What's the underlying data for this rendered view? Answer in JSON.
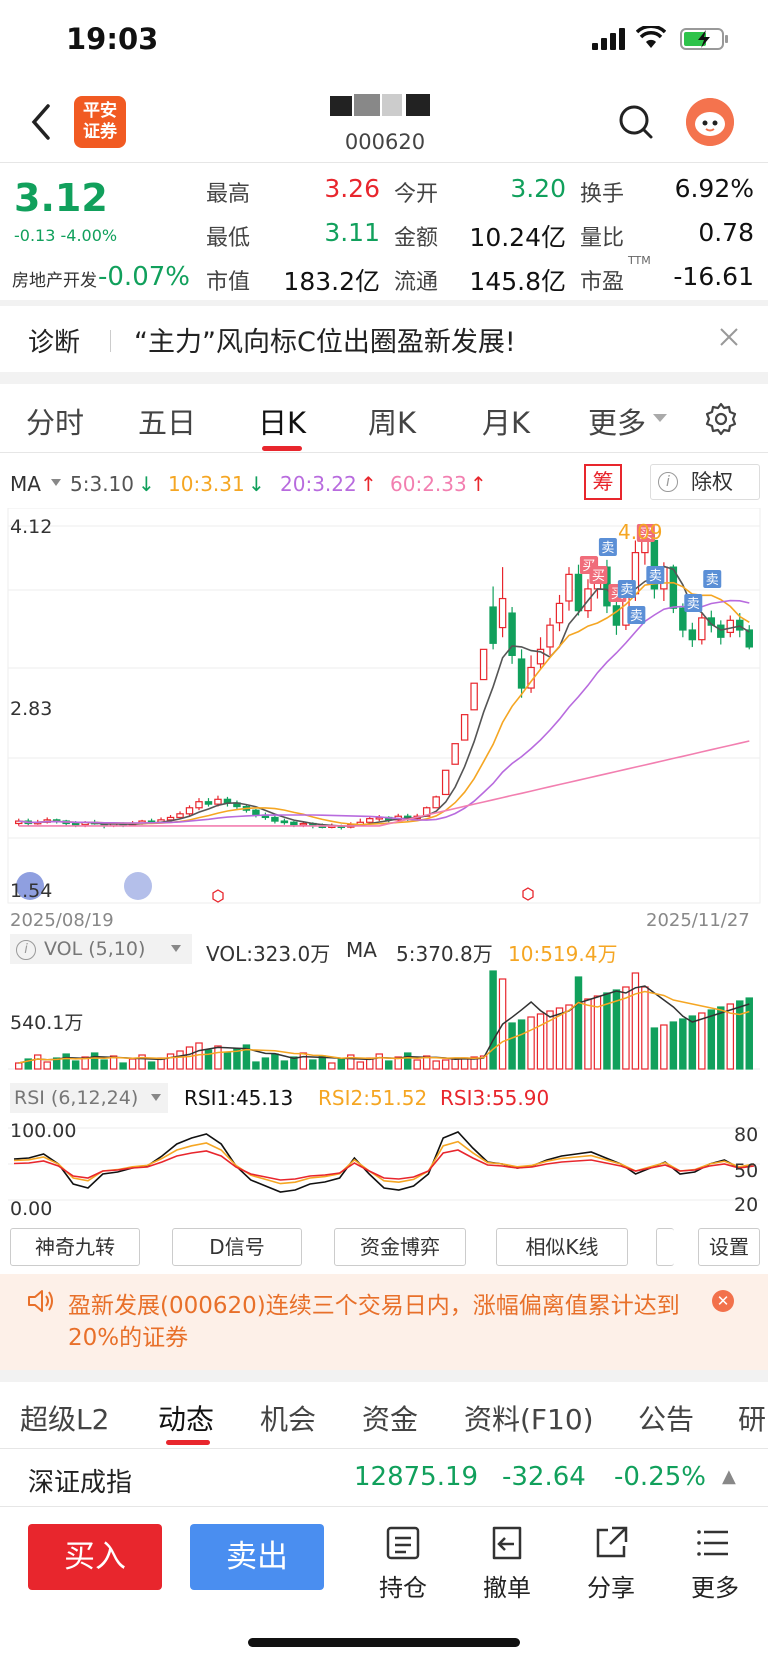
{
  "status": {
    "time": "19:03"
  },
  "header": {
    "logo_text": "平安\n证券",
    "stock_code": "000620"
  },
  "quote": {
    "price": "3.12",
    "change": "-0.13 -4.00%",
    "sector_name": "房地产开发",
    "sector_change": "-0.07%",
    "fields": [
      {
        "label": "最高",
        "value": "3.26",
        "color": "red"
      },
      {
        "label": "今开",
        "value": "3.20",
        "color": "green"
      },
      {
        "label": "换手",
        "value": "6.92%",
        "color": "dark"
      },
      {
        "label": "最低",
        "value": "3.11",
        "color": "green"
      },
      {
        "label": "金额",
        "value": "10.24亿",
        "color": "dark"
      },
      {
        "label": "量比",
        "value": "0.78",
        "color": "dark"
      },
      {
        "label": "市值",
        "value": "183.2亿",
        "color": "dark"
      },
      {
        "label": "流通",
        "value": "145.8亿",
        "color": "dark"
      },
      {
        "label": "市盈",
        "value": "-16.61",
        "color": "dark",
        "sup": "TTM"
      }
    ]
  },
  "diagnosis": {
    "label": "诊断",
    "text": "“主力”风向标C位出圈盈新发展!"
  },
  "period_tabs": [
    "分时",
    "五日",
    "日K",
    "周K",
    "月K",
    "更多"
  ],
  "active_period": "日K",
  "ma_bar": {
    "label": "MA",
    "ma5": "5:3.10",
    "ma10": "10:3.31",
    "ma20": "20:3.22",
    "ma60": "60:2.33",
    "chou": "筹",
    "chuquan": "除权"
  },
  "colors": {
    "ma5": "#555555",
    "ma10": "#f5a623",
    "ma20": "#b86bde",
    "ma60": "#f27fb0",
    "up": "#e8262d",
    "down": "#11a05c"
  },
  "chart_data": {
    "type": "candlestick",
    "y_top_label": "4.12",
    "y_mid_label": "2.83",
    "y_bottom_label": "1.54",
    "x_start": "2025/08/19",
    "x_end": "2025/11/27",
    "peak_label": "4.09",
    "ylim": [
      1.54,
      4.12
    ],
    "buy_marker": "买",
    "sell_marker": "卖"
  },
  "vol": {
    "header": "VOL (5,10)",
    "vol_value": "VOL:323.0万",
    "ma_label": "MA",
    "ma5": "5:370.8万",
    "ma10": "10:519.4万",
    "axis_label": "540.1万"
  },
  "rsi": {
    "header": "RSI (6,12,24)",
    "rsi1": "RSI1:45.13",
    "rsi2": "RSI2:51.52",
    "rsi3": "RSI3:55.90",
    "top": "100.00",
    "bottom": "0.00",
    "r80": "80",
    "r50": "50",
    "r20": "20"
  },
  "tools": [
    "神奇九转",
    "D信号",
    "资金博弈",
    "相似K线",
    "设置"
  ],
  "notice": {
    "text": "盈新发展(000620)连续三个交易日内，涨幅偏离值累计达到20%的证券"
  },
  "bottom_tabs": [
    "超级L2",
    "动态",
    "机会",
    "资金",
    "资料(F10)",
    "公告",
    "研"
  ],
  "index": {
    "name": "深证成指",
    "value": "12875.19",
    "change": "-32.64",
    "pct": "-0.25%"
  },
  "actions": {
    "buy": "买入",
    "sell": "卖出",
    "position": "持仓",
    "cancel": "撤单",
    "share": "分享",
    "more": "更多"
  }
}
